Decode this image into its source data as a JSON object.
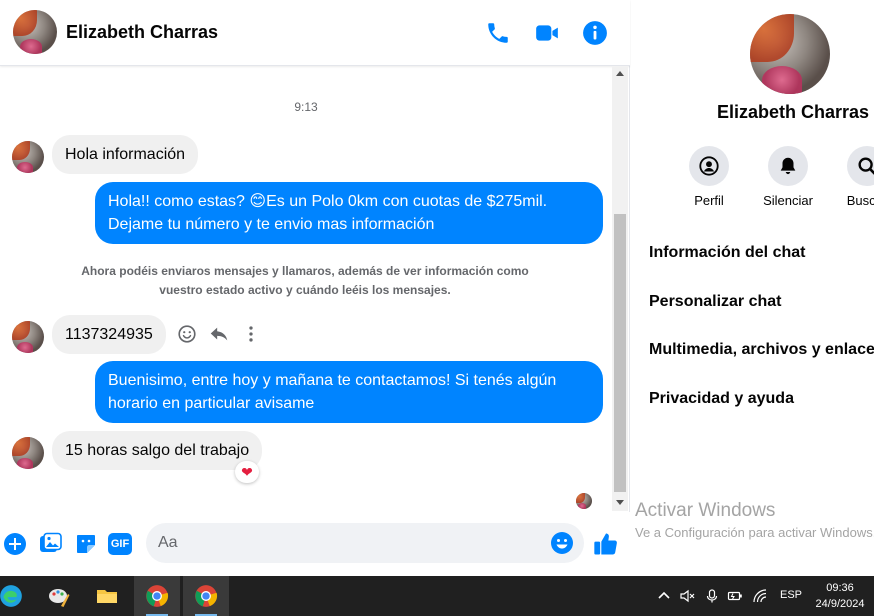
{
  "chat": {
    "contact_name": "Elizabeth Charras",
    "timestamp": "9:13",
    "messages": {
      "m1": "Hola información",
      "m2_line1": "Hola!! como estas? 😊Es un Polo 0km con cuotas de $275mil.",
      "m2_line2": "Dejame tu número y te envio mas información",
      "notice_line1": "Ahora podéis enviaros mensajes y llamaros, además de ver información como",
      "notice_line2": "vuestro estado activo y cuándo leéis los mensajes.",
      "m3": "1137324935",
      "m4_line1": "Buenisimo, entre hoy y mañana te contactamos! Si tenés algún",
      "m4_line2": "horario en particular avisame",
      "m5": "15 horas salgo del trabajo",
      "m5_reaction": "❤"
    },
    "composer": {
      "placeholder": "Aa",
      "gif_label": "GIF"
    }
  },
  "info_panel": {
    "name": "Elizabeth Charras",
    "actions": [
      "Perfil",
      "Silenciar",
      "Buscar"
    ],
    "menu": [
      "Información del chat",
      "Personalizar chat",
      "Multimedia, archivos y enlaces",
      "Privacidad y ayuda"
    ],
    "watermark_title": "Activar Windows",
    "watermark_sub": "Ve a Configuración para activar Windows."
  },
  "taskbar": {
    "language": "ESP",
    "time": "09:36",
    "date": "24/9/2024"
  },
  "colors": {
    "accent": "#0084ff",
    "incoming_bubble": "#f0f0f0",
    "taskbar": "#202020"
  }
}
